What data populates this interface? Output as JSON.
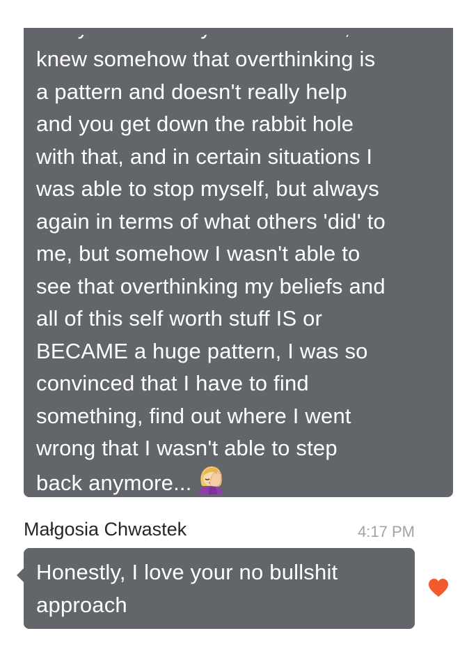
{
  "colors": {
    "bubble": "#62666b",
    "bubble_text": "#ffffff",
    "sender": "#262626",
    "timestamp": "#a3a3a3",
    "heart": "#f25a2c"
  },
  "message_1": {
    "partial_top_line": "really and actually understood it,",
    "lines": [
      "knew somehow that overthinking is",
      "a pattern and doesn't really help",
      "and you get down the rabbit hole",
      "with that, and in certain situations I",
      "was able to stop myself, but always",
      "again in terms of what others 'did' to",
      "me, but somehow I wasn't able to",
      "see that overthinking my beliefs and",
      "all of this self worth stuff IS or",
      "BECAME a huge pattern, I was so",
      "convinced that I have to find",
      "something, find out where I went",
      "wrong that I wasn't able to step",
      "back anymore..."
    ],
    "emoji": "woman-facepalming-icon"
  },
  "message_2": {
    "sender": "Małgosia Chwastek",
    "time": "4:17 PM",
    "lines": [
      "Honestly, I love your no bullshit",
      "approach"
    ],
    "reaction": "heart-icon"
  }
}
